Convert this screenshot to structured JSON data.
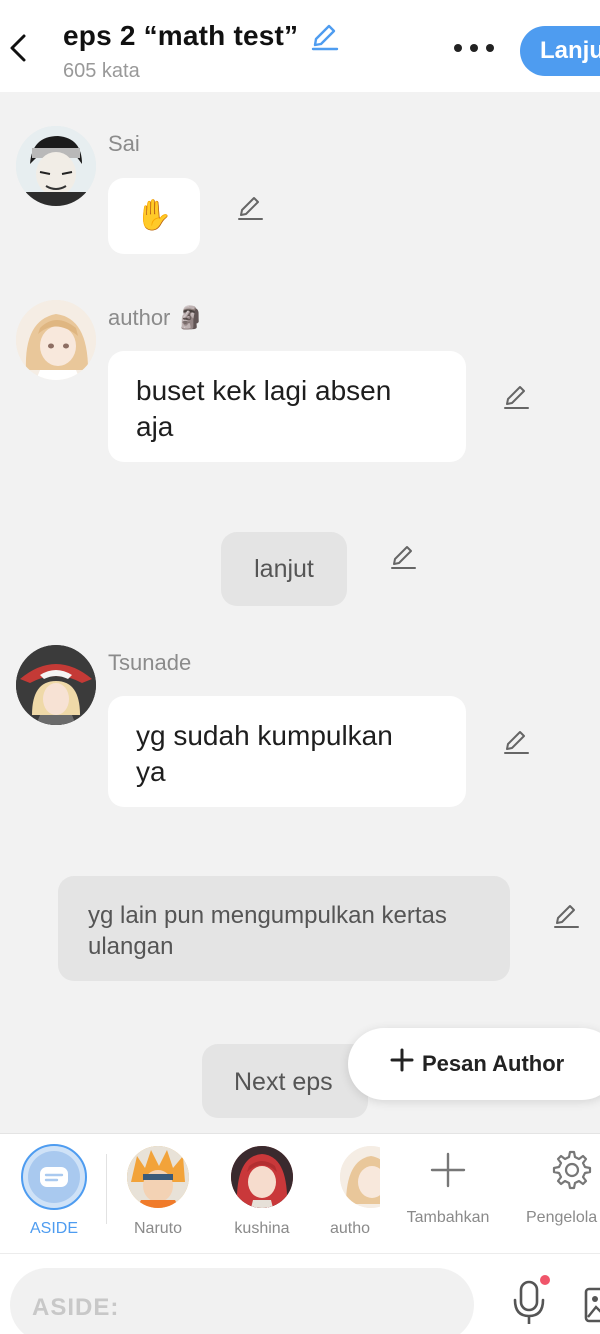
{
  "header": {
    "title": "eps 2 “math test”",
    "word_count": "605 kata",
    "continue_label": "Lanjut"
  },
  "messages": [
    {
      "sender": "Sai",
      "text": "✋"
    },
    {
      "sender": "author 🗿",
      "text_line1": "buset kek lagi absen",
      "text_line2": "aja"
    },
    {
      "narration": "lanjut"
    },
    {
      "sender": "Tsunade",
      "text_line1": "yg sudah kumpulkan",
      "text_line2": "ya"
    },
    {
      "narration_line1": "yg lain pun mengumpulkan kertas",
      "narration_line2": "ulangan"
    },
    {
      "narration": "Next eps"
    }
  ],
  "floating": {
    "add_author_message": "Pesan Author"
  },
  "characters": [
    {
      "name": "ASIDE"
    },
    {
      "name": "Naruto"
    },
    {
      "name": "kushina"
    },
    {
      "name": "autho"
    },
    {
      "name": "Tambahkan"
    },
    {
      "name": "Pengelola"
    }
  ],
  "composer": {
    "placeholder": "ASIDE:"
  },
  "colors": {
    "accent": "#4e9cf0",
    "background": "#f2f2f2",
    "bubble": "#ffffff",
    "narration": "#e4e4e4",
    "notification_dot": "#f0556a"
  },
  "icons": [
    "back-icon",
    "edit-icon",
    "more-icon",
    "plus-icon",
    "settings-icon",
    "mic-icon",
    "image-icon",
    "moai-emoji"
  ]
}
